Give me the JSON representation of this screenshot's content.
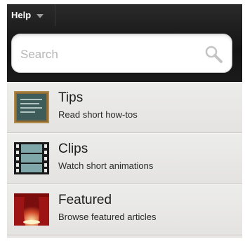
{
  "app_menu": {
    "label": "Help"
  },
  "search": {
    "placeholder": "Search",
    "value": ""
  },
  "items": [
    {
      "title": "Tips",
      "subtitle": "Read short how-tos",
      "icon": "chalkboard-icon"
    },
    {
      "title": "Clips",
      "subtitle": "Watch short animations",
      "icon": "filmstrip-icon"
    },
    {
      "title": "Featured",
      "subtitle": "Browse featured articles",
      "icon": "stage-curtain-icon"
    }
  ],
  "colors": {
    "topbar": "#1b1b1b",
    "list_bg": "#e9e8e6",
    "text": "#1d1d1d"
  }
}
